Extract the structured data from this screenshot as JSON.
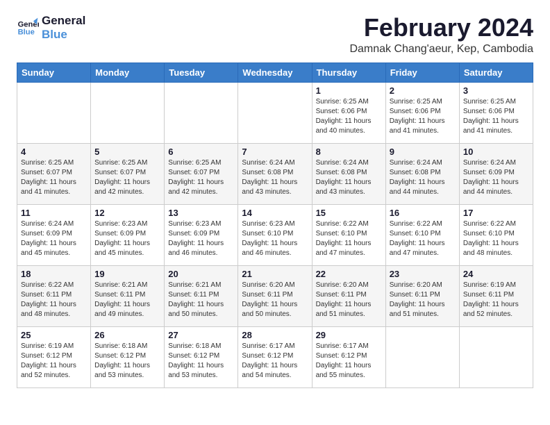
{
  "logo": {
    "line1": "General",
    "line2": "Blue"
  },
  "title": "February 2024",
  "subtitle": "Damnak Chang'aeur, Kep, Cambodia",
  "days_of_week": [
    "Sunday",
    "Monday",
    "Tuesday",
    "Wednesday",
    "Thursday",
    "Friday",
    "Saturday"
  ],
  "weeks": [
    [
      {
        "day": "",
        "info": ""
      },
      {
        "day": "",
        "info": ""
      },
      {
        "day": "",
        "info": ""
      },
      {
        "day": "",
        "info": ""
      },
      {
        "day": "1",
        "info": "Sunrise: 6:25 AM\nSunset: 6:06 PM\nDaylight: 11 hours\nand 40 minutes."
      },
      {
        "day": "2",
        "info": "Sunrise: 6:25 AM\nSunset: 6:06 PM\nDaylight: 11 hours\nand 41 minutes."
      },
      {
        "day": "3",
        "info": "Sunrise: 6:25 AM\nSunset: 6:06 PM\nDaylight: 11 hours\nand 41 minutes."
      }
    ],
    [
      {
        "day": "4",
        "info": "Sunrise: 6:25 AM\nSunset: 6:07 PM\nDaylight: 11 hours\nand 41 minutes."
      },
      {
        "day": "5",
        "info": "Sunrise: 6:25 AM\nSunset: 6:07 PM\nDaylight: 11 hours\nand 42 minutes."
      },
      {
        "day": "6",
        "info": "Sunrise: 6:25 AM\nSunset: 6:07 PM\nDaylight: 11 hours\nand 42 minutes."
      },
      {
        "day": "7",
        "info": "Sunrise: 6:24 AM\nSunset: 6:08 PM\nDaylight: 11 hours\nand 43 minutes."
      },
      {
        "day": "8",
        "info": "Sunrise: 6:24 AM\nSunset: 6:08 PM\nDaylight: 11 hours\nand 43 minutes."
      },
      {
        "day": "9",
        "info": "Sunrise: 6:24 AM\nSunset: 6:08 PM\nDaylight: 11 hours\nand 44 minutes."
      },
      {
        "day": "10",
        "info": "Sunrise: 6:24 AM\nSunset: 6:09 PM\nDaylight: 11 hours\nand 44 minutes."
      }
    ],
    [
      {
        "day": "11",
        "info": "Sunrise: 6:24 AM\nSunset: 6:09 PM\nDaylight: 11 hours\nand 45 minutes."
      },
      {
        "day": "12",
        "info": "Sunrise: 6:23 AM\nSunset: 6:09 PM\nDaylight: 11 hours\nand 45 minutes."
      },
      {
        "day": "13",
        "info": "Sunrise: 6:23 AM\nSunset: 6:09 PM\nDaylight: 11 hours\nand 46 minutes."
      },
      {
        "day": "14",
        "info": "Sunrise: 6:23 AM\nSunset: 6:10 PM\nDaylight: 11 hours\nand 46 minutes."
      },
      {
        "day": "15",
        "info": "Sunrise: 6:22 AM\nSunset: 6:10 PM\nDaylight: 11 hours\nand 47 minutes."
      },
      {
        "day": "16",
        "info": "Sunrise: 6:22 AM\nSunset: 6:10 PM\nDaylight: 11 hours\nand 47 minutes."
      },
      {
        "day": "17",
        "info": "Sunrise: 6:22 AM\nSunset: 6:10 PM\nDaylight: 11 hours\nand 48 minutes."
      }
    ],
    [
      {
        "day": "18",
        "info": "Sunrise: 6:22 AM\nSunset: 6:11 PM\nDaylight: 11 hours\nand 48 minutes."
      },
      {
        "day": "19",
        "info": "Sunrise: 6:21 AM\nSunset: 6:11 PM\nDaylight: 11 hours\nand 49 minutes."
      },
      {
        "day": "20",
        "info": "Sunrise: 6:21 AM\nSunset: 6:11 PM\nDaylight: 11 hours\nand 50 minutes."
      },
      {
        "day": "21",
        "info": "Sunrise: 6:20 AM\nSunset: 6:11 PM\nDaylight: 11 hours\nand 50 minutes."
      },
      {
        "day": "22",
        "info": "Sunrise: 6:20 AM\nSunset: 6:11 PM\nDaylight: 11 hours\nand 51 minutes."
      },
      {
        "day": "23",
        "info": "Sunrise: 6:20 AM\nSunset: 6:11 PM\nDaylight: 11 hours\nand 51 minutes."
      },
      {
        "day": "24",
        "info": "Sunrise: 6:19 AM\nSunset: 6:11 PM\nDaylight: 11 hours\nand 52 minutes."
      }
    ],
    [
      {
        "day": "25",
        "info": "Sunrise: 6:19 AM\nSunset: 6:12 PM\nDaylight: 11 hours\nand 52 minutes."
      },
      {
        "day": "26",
        "info": "Sunrise: 6:18 AM\nSunset: 6:12 PM\nDaylight: 11 hours\nand 53 minutes."
      },
      {
        "day": "27",
        "info": "Sunrise: 6:18 AM\nSunset: 6:12 PM\nDaylight: 11 hours\nand 53 minutes."
      },
      {
        "day": "28",
        "info": "Sunrise: 6:17 AM\nSunset: 6:12 PM\nDaylight: 11 hours\nand 54 minutes."
      },
      {
        "day": "29",
        "info": "Sunrise: 6:17 AM\nSunset: 6:12 PM\nDaylight: 11 hours\nand 55 minutes."
      },
      {
        "day": "",
        "info": ""
      },
      {
        "day": "",
        "info": ""
      }
    ]
  ]
}
